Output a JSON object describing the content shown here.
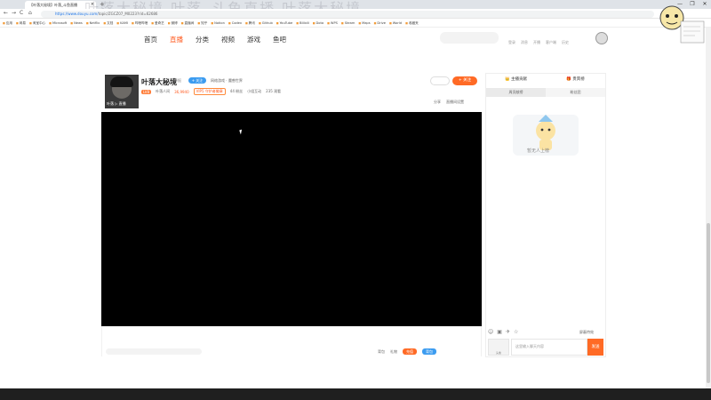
{
  "browser": {
    "tab_title": "【叶落大秘境】叶落_斗鱼直播",
    "tab_close": "×",
    "new_tab": "+",
    "window_controls": [
      "—",
      "❐",
      "✕"
    ],
    "overlay_title": "叶落大秘境 叶落_斗鱼直播 叶落大秘境",
    "nav": {
      "back": "←",
      "forward": "→",
      "reload": "C",
      "home": "⌂"
    },
    "url_host": "https://www.douyu.com/",
    "url_path": "topic/ZGCZ07_M0223?rid=62686",
    "bookmarks": [
      "应用",
      "网易",
      "淘宝中心",
      "Microsoft",
      "News",
      "Netflix",
      "文档",
      "KAMI",
      "哔哩哔哩",
      "爱奇艺",
      "微博",
      "直播间",
      "知乎",
      "Notion",
      "Codex",
      "腾讯",
      "Github",
      "YouTube",
      "Bilibili",
      "Dota",
      "WPS",
      "Steam",
      "Maps",
      "Drive",
      "World",
      "收藏夹"
    ]
  },
  "site_nav": {
    "items": [
      "首页",
      "直播",
      "分类",
      "视频",
      "游戏",
      "鱼吧"
    ],
    "active_index": 1,
    "header_links": [
      "登录",
      "消息",
      "开播",
      "客户端",
      "历史"
    ]
  },
  "streamer": {
    "name": "叶落大秘境",
    "stream_label": "举报",
    "follow_pill": "+ 关注",
    "category": "网络游戏 · 魔兽世界",
    "avatar_tag": "叶落 ▷ 直播",
    "level_badge": "LV8",
    "fan_badge": "叶落人间",
    "hotness": "36,9940",
    "guard_badge": "VIP5 守护者徽章",
    "fans": "44 粉丝",
    "stats_extra": "小组互动",
    "viewers": "235 观看"
  },
  "actions": {
    "share_btn": "",
    "follow_btn": "+ 关注",
    "share": "分享",
    "report": "直播间设置"
  },
  "bottom_bar": {
    "gift_placeholder": "",
    "bag": "背包",
    "gift": "礼物",
    "recharge": "充值",
    "backpack": "背包"
  },
  "right_panel": {
    "tabs": [
      "👑 主播贡献",
      "🎁 贵宾榜"
    ],
    "sub_tabs": [
      "周贡献榜",
      "粉丝团"
    ],
    "empty_text": "暂无人上榜",
    "block_fx": "屏蔽特效",
    "chat_placeholder": "这里输入聊天内容",
    "send": "发送",
    "chat_avatar_text": "头像"
  },
  "colors": {
    "accent": "#ff6a25",
    "blue": "#3c9cf0",
    "video_bg": "#000000"
  }
}
